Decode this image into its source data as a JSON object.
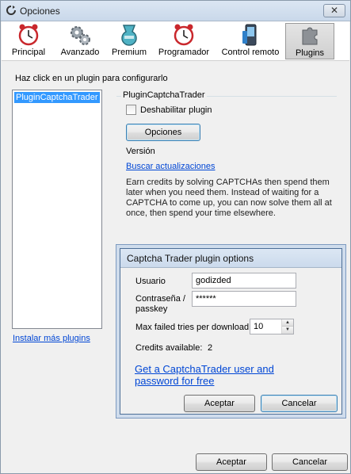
{
  "window": {
    "title": "Opciones",
    "close_glyph": "✕"
  },
  "toolbar": {
    "items": [
      {
        "label": "Principal",
        "icon": "alarm-clock-icon"
      },
      {
        "label": "Avanzado",
        "icon": "gears-icon"
      },
      {
        "label": "Premium",
        "icon": "premium-flask-icon"
      },
      {
        "label": "Programador",
        "icon": "alarm-clock-icon"
      },
      {
        "label": "Control remoto",
        "icon": "mobile-phone-icon"
      },
      {
        "label": "Plugins",
        "icon": "puzzle-piece-icon"
      }
    ],
    "active": "Plugins"
  },
  "plugins": {
    "hint": "Haz click en un plugin para configurarlo",
    "list": [
      "PluginCaptchaTrader"
    ],
    "install_link": "Instalar más plugins",
    "group_title": "PluginCaptchaTrader",
    "disable_label": "Deshabilitar plugin",
    "options_button": "Opciones",
    "version_label": "Versión",
    "update_link": "Buscar actualizaciones",
    "description": "Earn credits by solving CAPTCHAs then spend them later when you need them. Instead of waiting for a CAPTCHA to come up, you can now solve them all at once, then spend your time elsewhere."
  },
  "dialog": {
    "title": "Captcha Trader plugin options",
    "user_label": "Usuario",
    "user_value": "godizded",
    "password_label_1": "Contraseña /",
    "password_label_2": "passkey",
    "password_value": "******",
    "max_tries_label": "Max failed tries per download",
    "max_tries_value": "10",
    "credits_label": "Credits available:",
    "credits_value": "2",
    "signup_link": "Get a CaptchaTrader user and password for free",
    "accept_button": "Aceptar",
    "cancel_button": "Cancelar"
  },
  "footer": {
    "accept_button": "Aceptar",
    "cancel_button": "Cancelar"
  }
}
